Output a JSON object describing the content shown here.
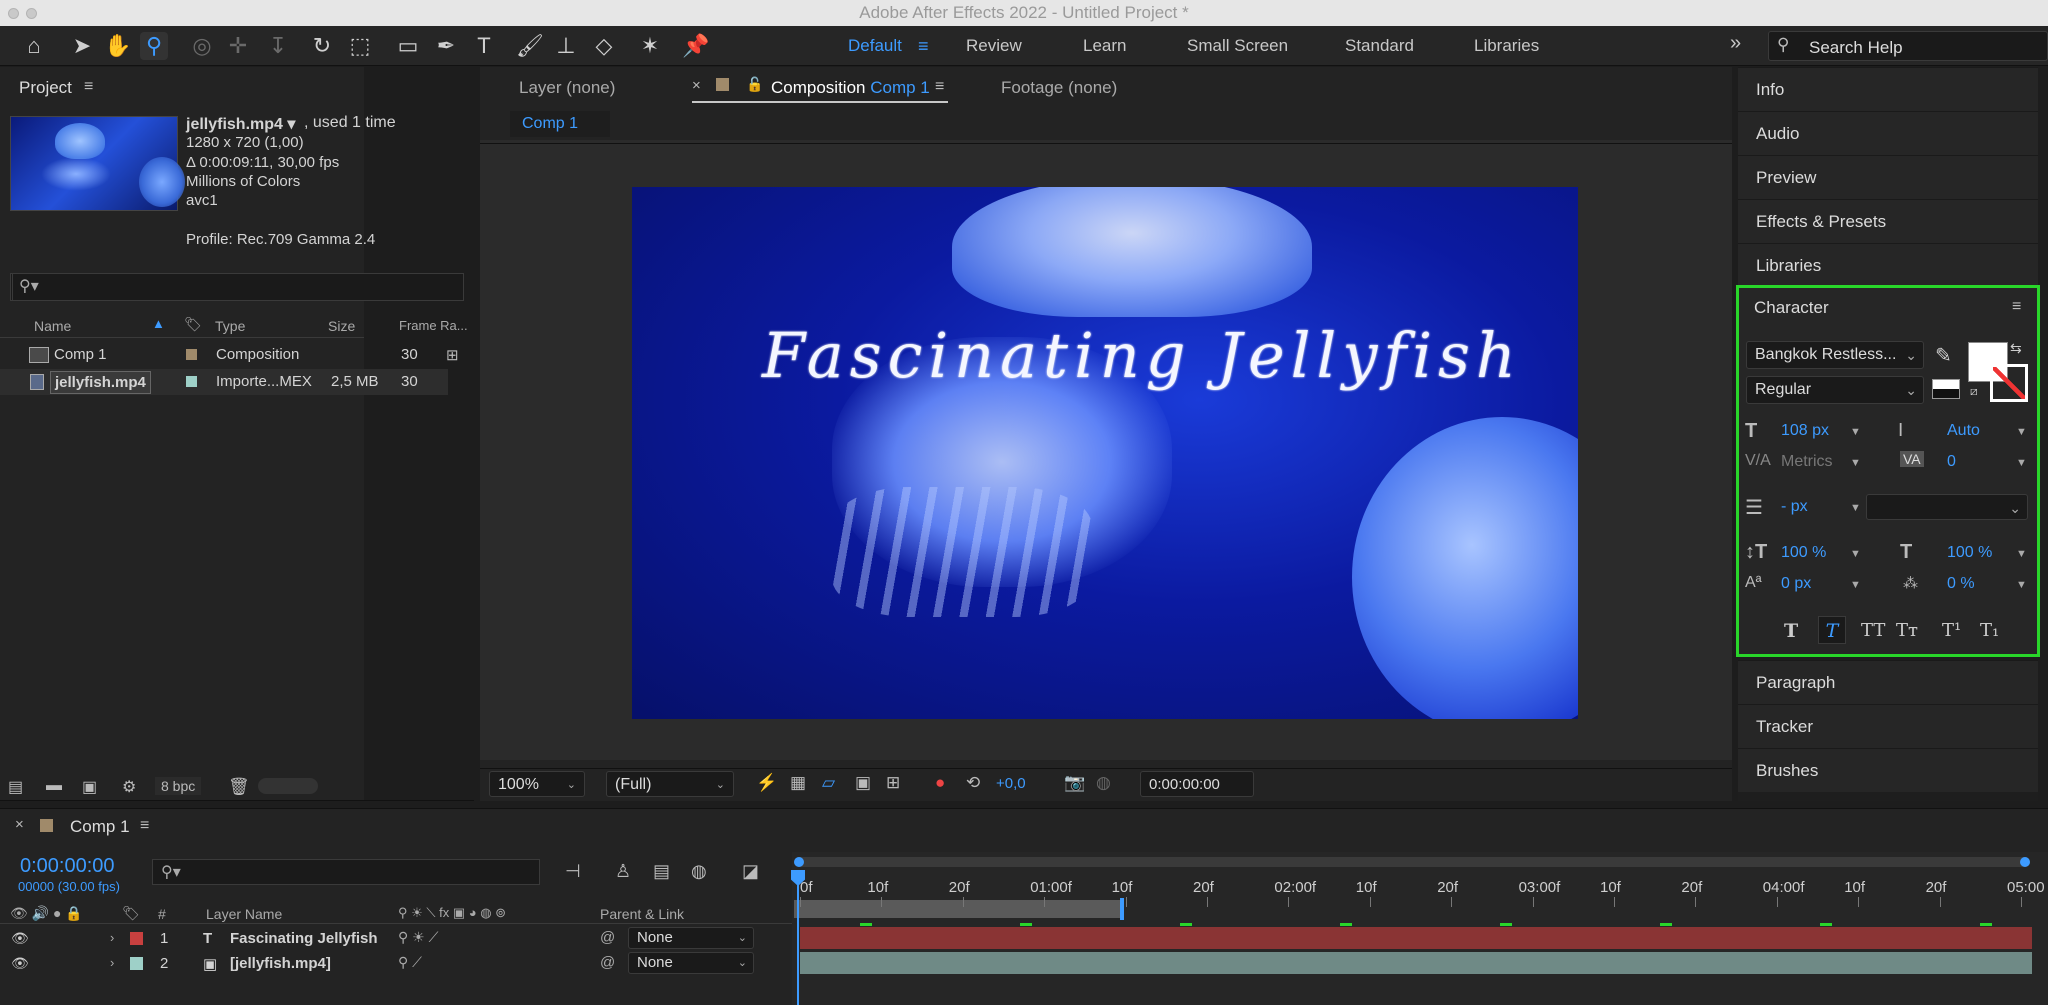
{
  "app": {
    "title": "Adobe After Effects 2022 - Untitled Project *"
  },
  "workspaces": [
    "Default",
    "Review",
    "Learn",
    "Small Screen",
    "Standard",
    "Libraries"
  ],
  "search": {
    "placeholder": "Search Help"
  },
  "project": {
    "title": "Project",
    "file": {
      "name": "jellyfish.mp4",
      "usage": ", used 1 time",
      "dimensions": "1280 x 720 (1,00)",
      "duration": "Δ 0:00:09:11, 30,00 fps",
      "colors": "Millions of Colors",
      "codec": "avc1",
      "profile": "Profile: Rec.709 Gamma 2.4"
    },
    "columns": {
      "name": "Name",
      "type": "Type",
      "size": "Size",
      "frame_rate": "Frame Ra..."
    },
    "items": [
      {
        "name": "Comp 1",
        "type": "Composition",
        "size": "",
        "fps": "30",
        "label_color": "#a08a6a"
      },
      {
        "name": "jellyfish.mp4",
        "type": "Importe...MEX",
        "size": "2,5 MB",
        "fps": "30",
        "label_color": "#9ed0c8"
      }
    ],
    "bpc": "8 bpc"
  },
  "viewer": {
    "tab_layer": "Layer",
    "tab_layer_val": "(none)",
    "tab_comp": "Composition",
    "tab_comp_val": "Comp 1",
    "tab_footage": "Footage",
    "tab_footage_val": "(none)",
    "breadcrumb": "Comp 1",
    "overlay_text": "Fascinating Jellyfish",
    "zoom": "100%",
    "resolution": "(Full)",
    "exposure": "+0,0",
    "timecode": "0:00:00:00"
  },
  "right_panels": [
    "Info",
    "Audio",
    "Preview",
    "Effects & Presets",
    "Libraries"
  ],
  "right_panels_after": [
    "Paragraph",
    "Tracker",
    "Brushes"
  ],
  "character": {
    "title": "Character",
    "font": "Bangkok Restless...",
    "style": "Regular",
    "size": "108 px",
    "leading": "Auto",
    "kerning": "Metrics",
    "tracking": "0",
    "stroke": "- px",
    "vscale": "100 %",
    "hscale": "100 %",
    "baseline": "0 px",
    "tsume": "0 %",
    "styles": [
      "T",
      "T",
      "TT",
      "Tт",
      "T¹",
      "T₁"
    ]
  },
  "timeline": {
    "comp": "Comp 1",
    "timecode": "0:00:00:00",
    "frames": "00000 (30.00 fps)",
    "col_layer": "Layer Name",
    "col_num": "#",
    "col_parent": "Parent & Link",
    "ruler": [
      "0f",
      "10f",
      "20f",
      "01:00f",
      "10f",
      "20f",
      "02:00f",
      "10f",
      "20f",
      "03:00f",
      "10f",
      "20f",
      "04:00f",
      "10f",
      "20f",
      "05:00"
    ],
    "layers": [
      {
        "num": "1",
        "name": "Fascinating Jellyfish",
        "parent": "None",
        "color": "#c8403f",
        "icon": "T"
      },
      {
        "num": "2",
        "name": "[jellyfish.mp4]",
        "parent": "None",
        "color": "#9ed0c8",
        "icon": "▣"
      }
    ]
  }
}
